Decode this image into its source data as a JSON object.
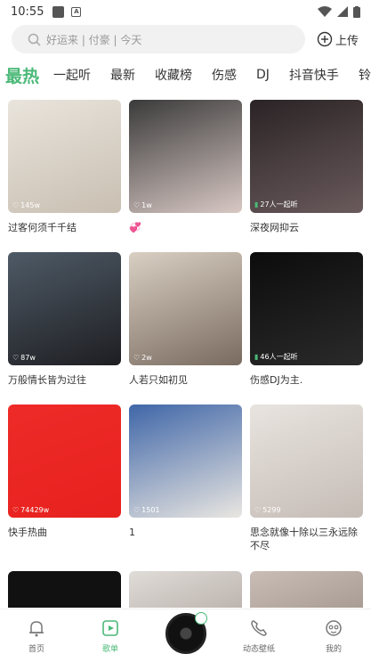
{
  "status_bar": {
    "time": "10:55"
  },
  "search": {
    "placeholder": "好运来 | 付豪 | 今天"
  },
  "upload_label": "上传",
  "tabs": [
    "最热",
    "一起听",
    "最新",
    "收藏榜",
    "伤感",
    "DJ",
    "抖音快手",
    "铃声"
  ],
  "playlists": [
    {
      "title": "过客何须千千结",
      "count": "145w",
      "count_icon": "thumb-icon",
      "colors": [
        "#e9e4dc",
        "#c9bfb2"
      ]
    },
    {
      "title": "💞",
      "count": "1w",
      "count_icon": "thumb-icon",
      "colors": [
        "#3a3a3a",
        "#d8c8c4"
      ]
    },
    {
      "title": "深夜网抑云",
      "count": "27人一起听",
      "count_icon": "bars-icon",
      "colors": [
        "#2a2325",
        "#6a5a5c"
      ]
    },
    {
      "title": "万般情长皆为过往",
      "count": "87w",
      "count_icon": "thumb-icon",
      "colors": [
        "#4e5a66",
        "#1e1e22"
      ]
    },
    {
      "title": "人若只如初见",
      "count": "2w",
      "count_icon": "thumb-icon",
      "colors": [
        "#d9cfc3",
        "#7a6b60"
      ]
    },
    {
      "title": "伤感DJ为主.",
      "count": "46人一起听",
      "count_icon": "bars-icon",
      "colors": [
        "#0c0c0c",
        "#2a2a2a"
      ]
    },
    {
      "title": "快手热曲",
      "count": "74429w",
      "count_icon": "thumb-icon",
      "colors": [
        "#ee2b28",
        "#e7211e"
      ]
    },
    {
      "title": "1",
      "count": "1501",
      "count_icon": "thumb-icon",
      "colors": [
        "#3f66a8",
        "#e9e6e1"
      ]
    },
    {
      "title": "思念就像十除以三永远除不尽",
      "count": "5299",
      "count_icon": "thumb-icon",
      "colors": [
        "#e8e4df",
        "#c6bcb6"
      ]
    },
    {
      "title": "",
      "count": "",
      "count_icon": "",
      "colors": [
        "#111111",
        "#111111"
      ]
    },
    {
      "title": "",
      "count": "",
      "count_icon": "",
      "colors": [
        "#e0dcd8",
        "#9a8e88"
      ]
    },
    {
      "title": "",
      "count": "",
      "count_icon": "",
      "colors": [
        "#c9bdb5",
        "#8a7c74"
      ]
    }
  ],
  "bottom_nav": [
    {
      "label": "首页",
      "icon": "bell-icon"
    },
    {
      "label": "歌单",
      "icon": "playlist-icon"
    },
    {
      "label": "动态壁纸",
      "icon": "phone-icon"
    },
    {
      "label": "我的",
      "icon": "avatar-icon"
    }
  ],
  "colors": {
    "accent": "#4bb978"
  }
}
